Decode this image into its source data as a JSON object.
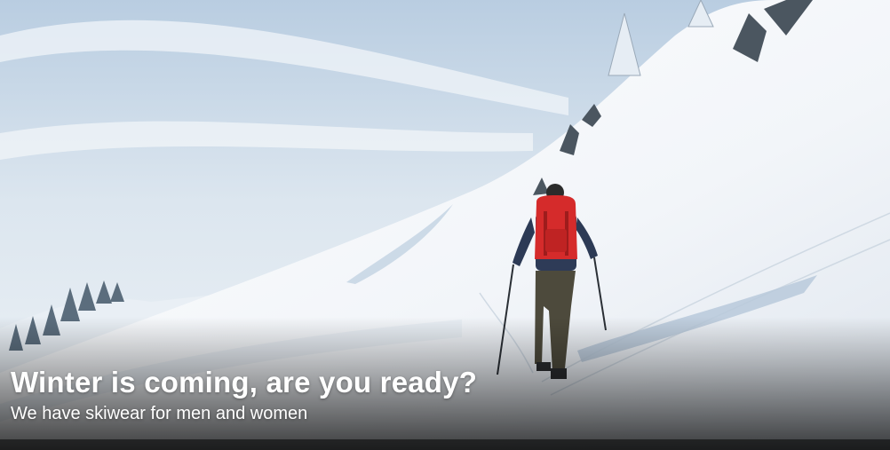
{
  "banner": {
    "headline": "Winter is coming, are you ready?",
    "subheadline": "We have skiwear for men and women"
  },
  "image": {
    "subject": "skier-hiking-up-snowy-slope",
    "colors": {
      "sky": "#dfe8f1",
      "snow": "#f4f7fa",
      "snow_shadow": "#c9d6e3",
      "backpack": "#d52b2b",
      "text": "#ffffff"
    }
  }
}
